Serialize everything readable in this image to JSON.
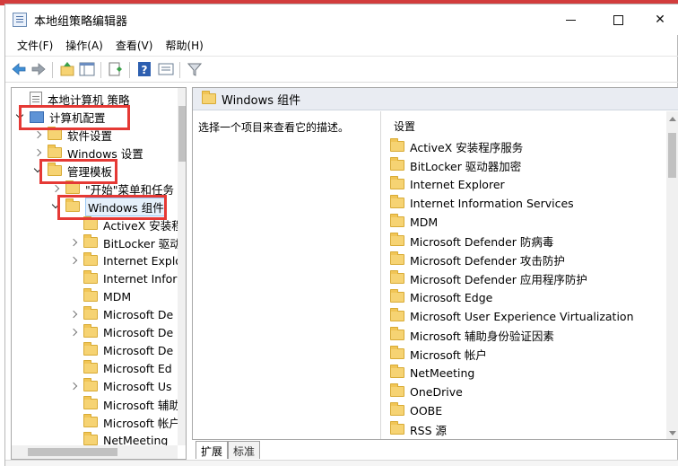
{
  "window": {
    "title": "本地组策略编辑器",
    "minimize_label": "—",
    "close_label": "✕"
  },
  "menu": [
    "文件(F)",
    "操作(A)",
    "查看(V)",
    "帮助(H)"
  ],
  "toolbar": {
    "icons": [
      "back-arrow-icon",
      "forward-arrow-icon",
      "up-folder-icon",
      "show-hide-tree-icon",
      "export-list-icon",
      "help-icon",
      "properties-icon",
      "filter-icon"
    ]
  },
  "tree": {
    "root": "本地计算机 策略",
    "computer_config": "计算机配置",
    "software_settings": "软件设置",
    "windows_settings": "Windows 设置",
    "admin_templates": "管理模板",
    "start_menu": "\"开始\"菜单和任务",
    "windows_components": "Windows 组件",
    "children": [
      "ActiveX 安装程",
      "BitLocker 驱动",
      "Internet Explo",
      "Internet Infor",
      "MDM",
      "Microsoft De",
      "Microsoft De",
      "Microsoft De",
      "Microsoft Ed",
      "Microsoft Us",
      "Microsoft 辅助",
      "Microsoft 帐户",
      "NetMeeting"
    ]
  },
  "right": {
    "header": "Windows 组件",
    "description": "选择一个项目来查看它的描述。",
    "settings_label": "设置",
    "items": [
      "ActiveX 安装程序服务",
      "BitLocker 驱动器加密",
      "Internet Explorer",
      "Internet Information Services",
      "MDM",
      "Microsoft Defender 防病毒",
      "Microsoft Defender 攻击防护",
      "Microsoft Defender 应用程序防护",
      "Microsoft Edge",
      "Microsoft User Experience Virtualization",
      "Microsoft 辅助身份验证因素",
      "Microsoft 帐户",
      "NetMeeting",
      "OneDrive",
      "OOBE",
      "RSS 源"
    ]
  },
  "tabs": [
    "扩展",
    "标准"
  ],
  "colors": {
    "highlight": "#e53935",
    "folder": "#f6d373",
    "header_bg": "#e9ecf2"
  }
}
